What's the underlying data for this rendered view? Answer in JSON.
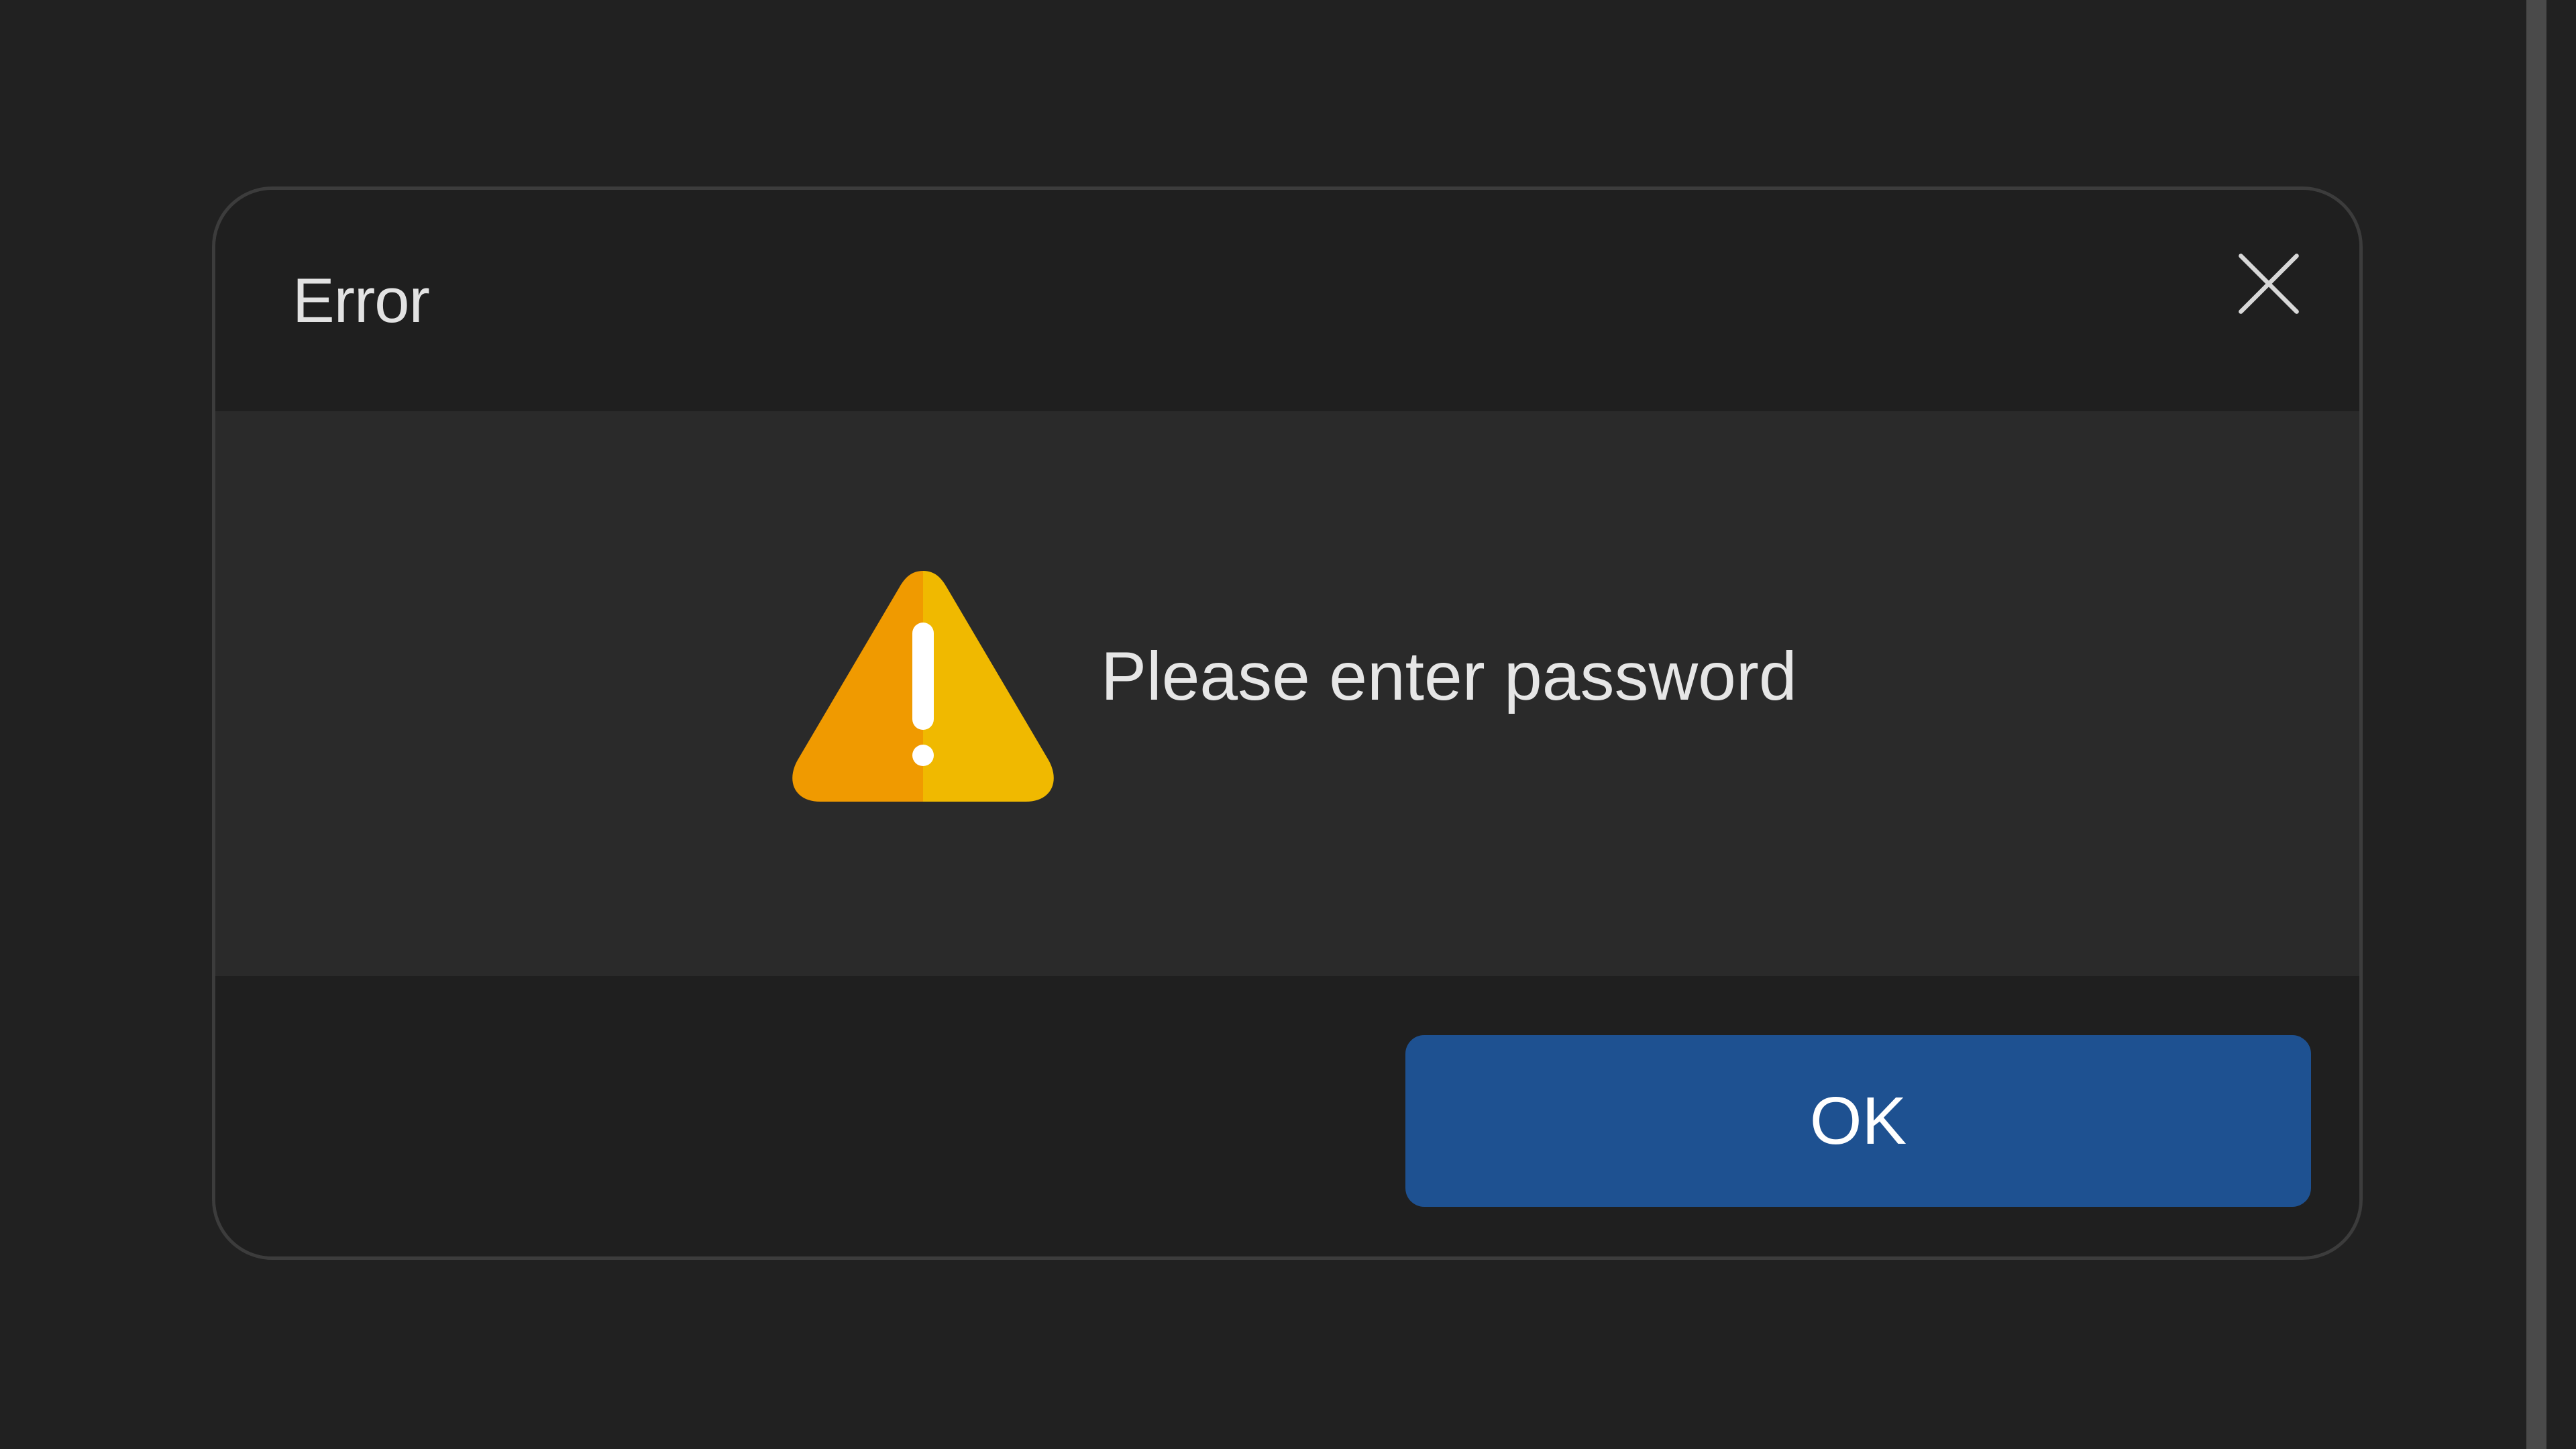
{
  "dialog": {
    "title": "Error",
    "message": "Please enter password",
    "ok_label": "OK",
    "close_icon": "close-icon",
    "warning_icon": "warning-icon"
  },
  "colors": {
    "background": "#212121",
    "dialog_header": "#1f1f1f",
    "dialog_body": "#2a2a2a",
    "primary_button": "#1e5191",
    "warning_left": "#f09a00",
    "warning_right": "#f0b900"
  }
}
